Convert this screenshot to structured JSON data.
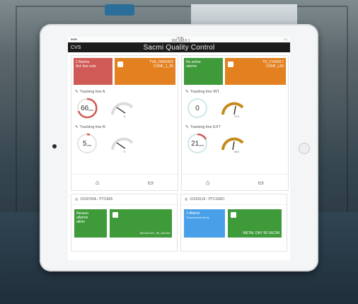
{
  "status": {
    "time": "9:41",
    "subtitle": "192.168.0.1"
  },
  "app": {
    "title": "Sacmi Quality Control",
    "back_label": "CVS"
  },
  "left_panel": {
    "alarm_tile": {
      "line1": "1 Alarms",
      "line2": "Act: line ovla"
    },
    "code_tile": {
      "line1": "TVA_CM00202",
      "line2": "CONF_1_35"
    },
    "sections": [
      {
        "label": "Tracking line A",
        "value": "66",
        "unit": "u/m",
        "dial_value": "0"
      },
      {
        "label": "Tracking line B",
        "value": "5",
        "unit": "u/m",
        "dial_value": "0"
      }
    ]
  },
  "right_panel": {
    "alarm_tile": {
      "line1": "No active",
      "line2": "alarms"
    },
    "code_tile": {
      "line1": "TD_CV00017",
      "line2": "CONF_L30"
    },
    "sections": [
      {
        "label": "Tracking line INT",
        "value": "0",
        "unit": "",
        "dial_value": "274"
      },
      {
        "label": "Tracking line EXT",
        "value": "21",
        "unit": "u/m",
        "dial_value": "300"
      }
    ]
  },
  "bottom_left": {
    "header": "1019700A - PTCA05",
    "tile1": {
      "line1": "Nessun",
      "line2": "allarme",
      "line3": "attivo"
    },
    "tile2": {
      "label": "METALDAY_95_SACMI"
    }
  },
  "bottom_right": {
    "header": "10163119 - PTCG60C",
    "tile1": {
      "line1": "1 Allarmi",
      "line2": "Trova event coi ris"
    },
    "tile2": {
      "label": "METAL DAY 95 SACMI"
    }
  },
  "colors": {
    "alarm_red": "#d05a55",
    "ok_green": "#3f9a3a",
    "code_orange": "#e38020",
    "info_blue": "#4aa0e8",
    "gauge_gold": "#c48a1a"
  }
}
